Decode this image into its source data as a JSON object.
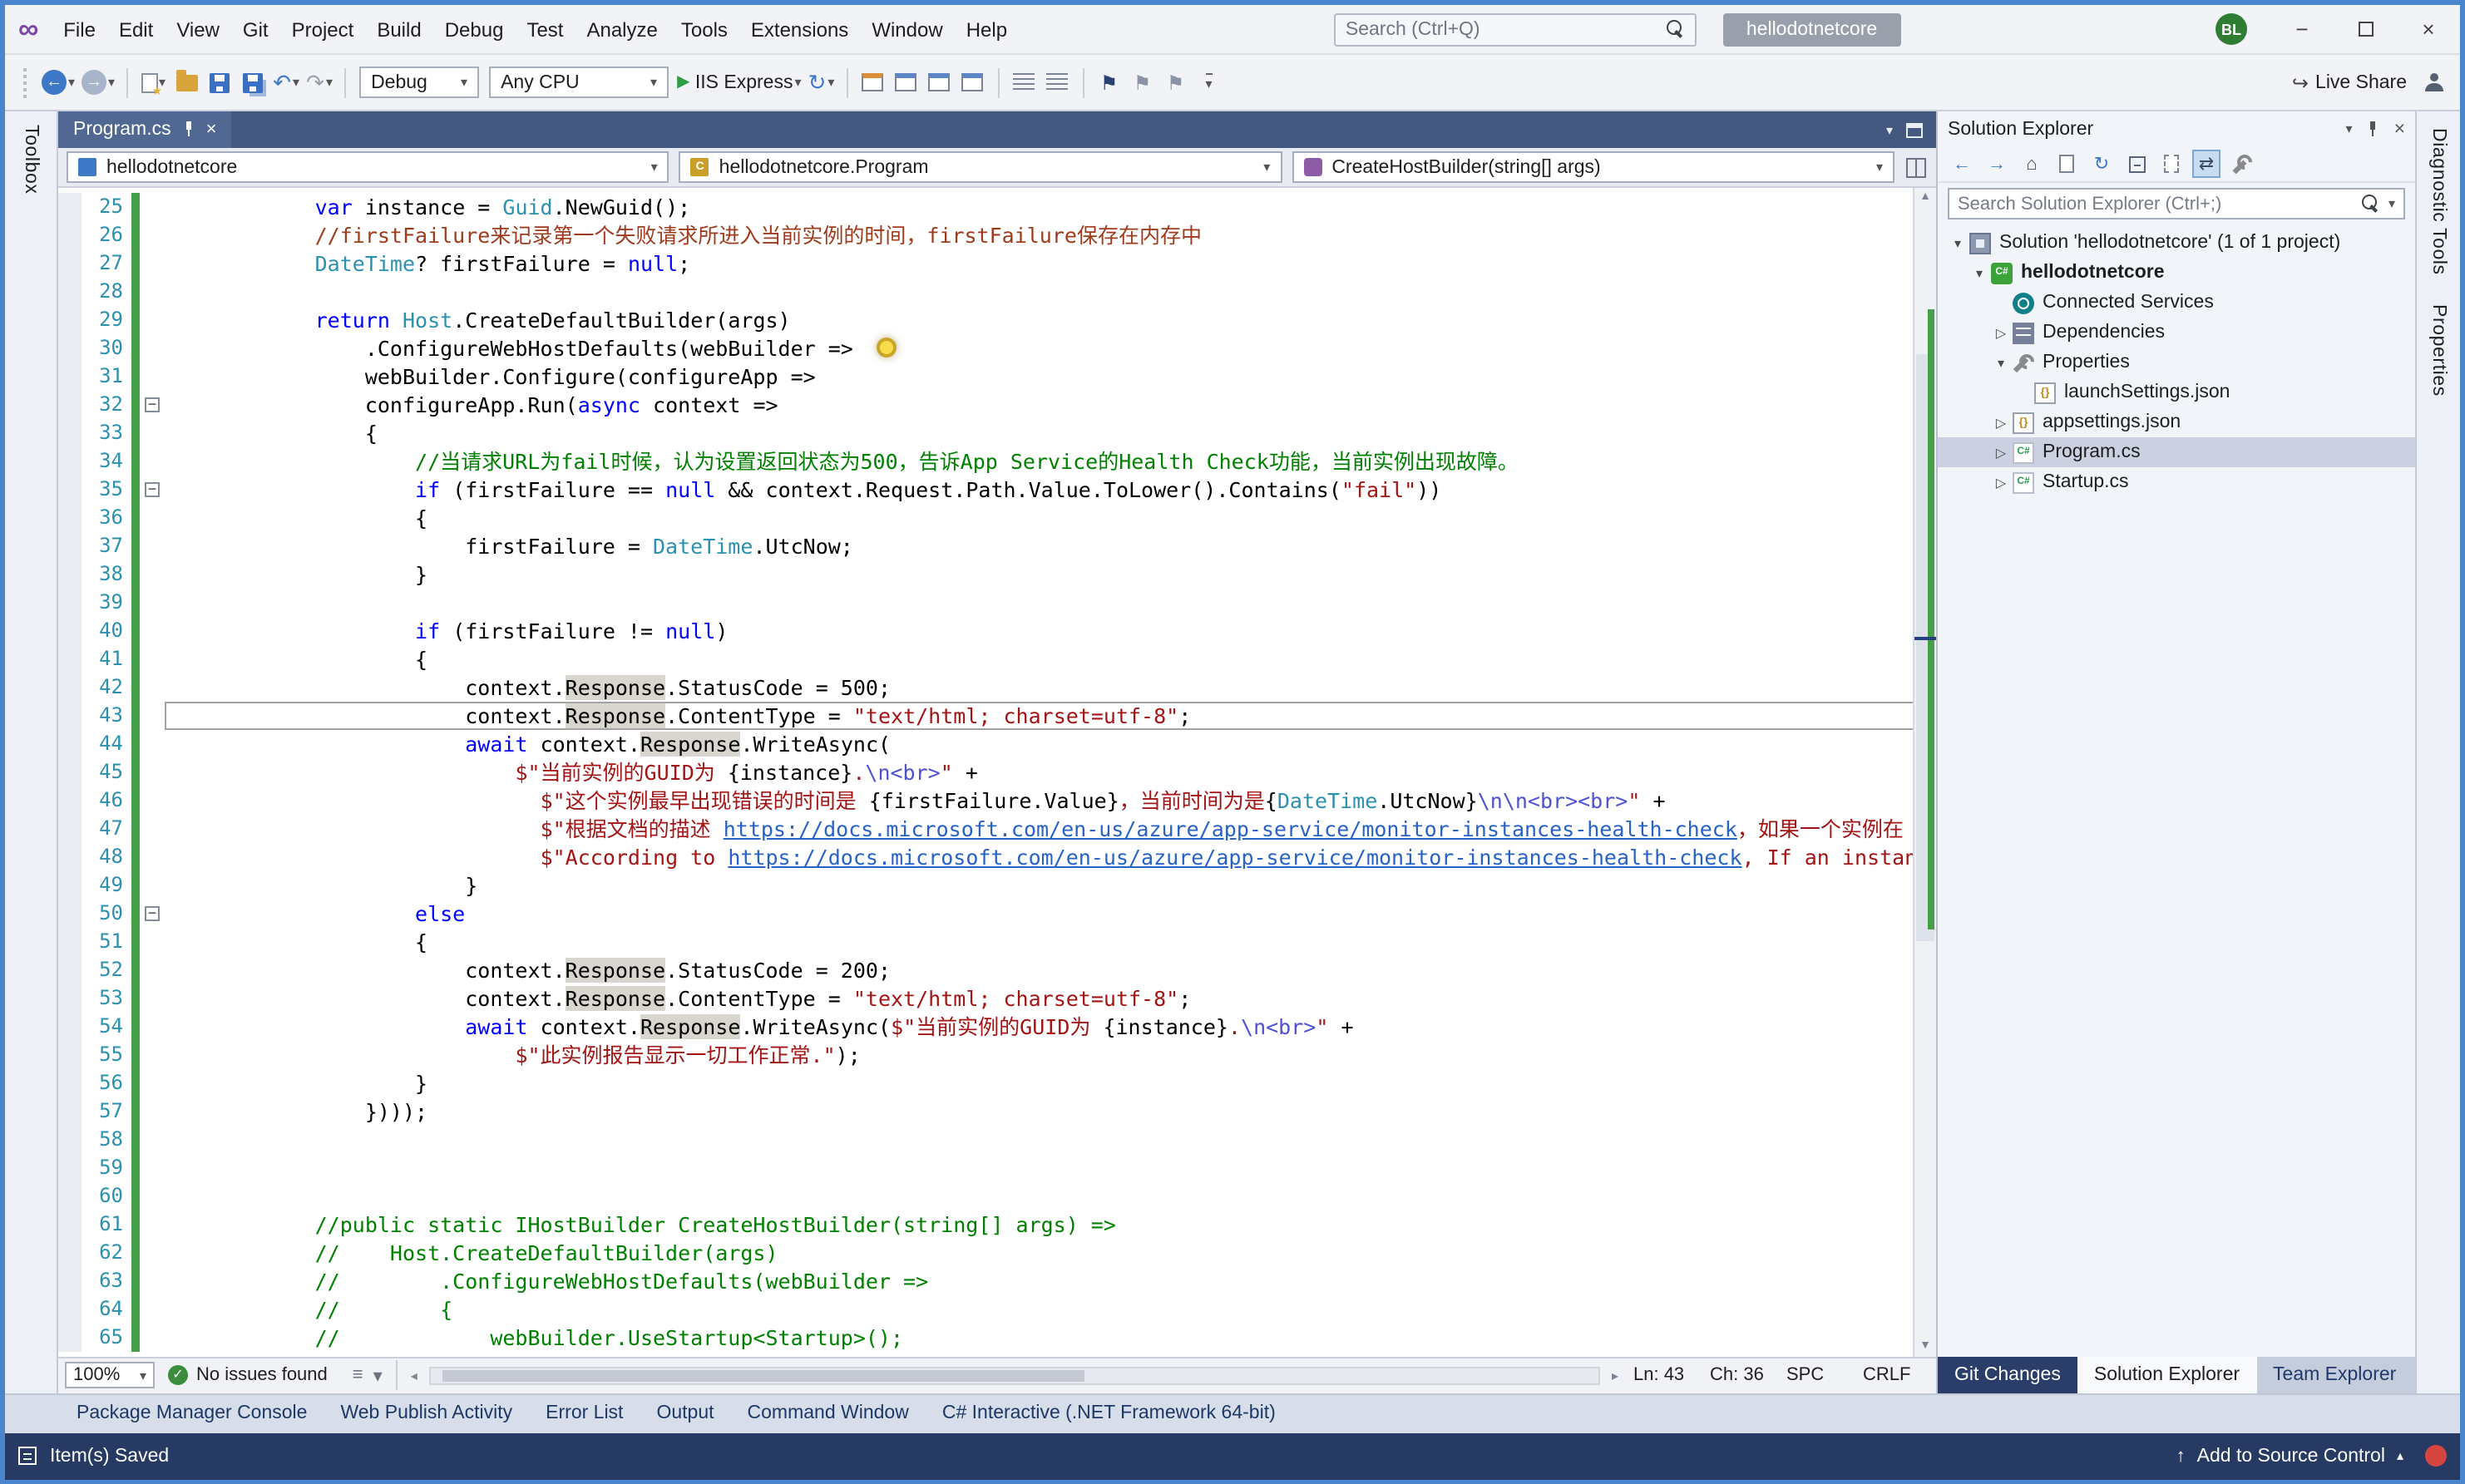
{
  "titlebar": {
    "menus": [
      "File",
      "Edit",
      "View",
      "Git",
      "Project",
      "Build",
      "Debug",
      "Test",
      "Analyze",
      "Tools",
      "Extensions",
      "Window",
      "Help"
    ],
    "search_placeholder": "Search (Ctrl+Q)",
    "solution_pill": "hellodotnetcore",
    "avatar": "BL"
  },
  "toolbar": {
    "config": "Debug",
    "platform": "Any CPU",
    "run": "IIS Express",
    "live_share": "Live Share"
  },
  "left_rail": {
    "toolbox_label": "Toolbox"
  },
  "right_rail": {
    "labels": [
      "Diagnostic Tools",
      "Properties"
    ]
  },
  "editor": {
    "tab": {
      "title": "Program.cs"
    },
    "navbar": {
      "project": "hellodotnetcore",
      "type": "hellodotnetcore.Program",
      "member": "CreateHostBuilder(string[] args)"
    },
    "statusbar": {
      "zoom": "100%",
      "issues": "No issues found",
      "ln": "Ln: 43",
      "ch": "Ch: 36",
      "ins": "SPC",
      "eol": "CRLF"
    },
    "code": {
      "lines": [
        {
          "n": 25,
          "segs": [
            [
              "p",
              "            "
            ],
            [
              "k",
              "var"
            ],
            [
              "p",
              " instance = "
            ],
            [
              "t",
              "Guid"
            ],
            [
              "p",
              ".NewGuid();"
            ]
          ]
        },
        {
          "n": 26,
          "segs": [
            [
              "cr",
              "            //firstFailure来记录第一个失败请求所进入当前实例的时间，firstFailure保存在内存中"
            ]
          ]
        },
        {
          "n": 27,
          "segs": [
            [
              "p",
              "            "
            ],
            [
              "t",
              "DateTime"
            ],
            [
              "p",
              "? firstFailure = "
            ],
            [
              "k",
              "null"
            ],
            [
              "p",
              ";"
            ]
          ]
        },
        {
          "n": 28,
          "segs": []
        },
        {
          "n": 29,
          "segs": [
            [
              "p",
              "            "
            ],
            [
              "k",
              "return"
            ],
            [
              "p",
              " "
            ],
            [
              "t",
              "Host"
            ],
            [
              "p",
              ".CreateDefaultBuilder(args)"
            ]
          ]
        },
        {
          "n": 30,
          "segs": [
            [
              "p",
              "                .ConfigureWebHostDefaults(webBuilder =>"
            ]
          ]
        },
        {
          "n": 31,
          "segs": [
            [
              "p",
              "                webBuilder.Configure(configureApp =>"
            ]
          ]
        },
        {
          "n": 32,
          "fold": true,
          "segs": [
            [
              "p",
              "                configureApp.Run("
            ],
            [
              "k",
              "async"
            ],
            [
              "p",
              " context =>"
            ]
          ]
        },
        {
          "n": 33,
          "segs": [
            [
              "p",
              "                {"
            ]
          ]
        },
        {
          "n": 34,
          "segs": [
            [
              "c",
              "                    //当请求URL为fail时候，认为设置返回状态为500，告诉App Service的Health Check功能，当前实例出现故障。"
            ]
          ]
        },
        {
          "n": 35,
          "fold": true,
          "segs": [
            [
              "p",
              "                    "
            ],
            [
              "k",
              "if"
            ],
            [
              "p",
              " (firstFailure == "
            ],
            [
              "k",
              "null"
            ],
            [
              "p",
              " && context.Request.Path.Value.ToLower().Contains("
            ],
            [
              "s",
              "\"fail\""
            ],
            [
              "p",
              "))"
            ]
          ]
        },
        {
          "n": 36,
          "segs": [
            [
              "p",
              "                    {"
            ]
          ]
        },
        {
          "n": 37,
          "segs": [
            [
              "p",
              "                        firstFailure = "
            ],
            [
              "t",
              "DateTime"
            ],
            [
              "p",
              ".UtcNow;"
            ]
          ]
        },
        {
          "n": 38,
          "segs": [
            [
              "p",
              "                    }"
            ]
          ]
        },
        {
          "n": 39,
          "segs": []
        },
        {
          "n": 40,
          "segs": [
            [
              "p",
              "                    "
            ],
            [
              "k",
              "if"
            ],
            [
              "p",
              " (firstFailure != "
            ],
            [
              "k",
              "null"
            ],
            [
              "p",
              ")"
            ]
          ]
        },
        {
          "n": 41,
          "segs": [
            [
              "p",
              "                    {"
            ]
          ]
        },
        {
          "n": 42,
          "segs": [
            [
              "p",
              "                        context."
            ],
            [
              "hl",
              "Response"
            ],
            [
              "p",
              ".StatusCode = 500;"
            ]
          ]
        },
        {
          "n": 43,
          "current": true,
          "segs": [
            [
              "p",
              "                        context."
            ],
            [
              "hl",
              "Response"
            ],
            [
              "p",
              ".ContentType = "
            ],
            [
              "s",
              "\"text/html; charset=utf-8\""
            ],
            [
              "p",
              ";"
            ]
          ]
        },
        {
          "n": 44,
          "segs": [
            [
              "p",
              "                        "
            ],
            [
              "k",
              "await"
            ],
            [
              "p",
              " context."
            ],
            [
              "hl",
              "Response"
            ],
            [
              "p",
              ".WriteAsync("
            ]
          ]
        },
        {
          "n": 45,
          "segs": [
            [
              "p",
              "                            "
            ],
            [
              "s",
              "$\"当前实例的GUID为 "
            ],
            [
              "p",
              "{instance}"
            ],
            [
              "s",
              "."
            ],
            [
              "e",
              "\\n<br>"
            ],
            [
              "s",
              "\""
            ],
            [
              "p",
              " +"
            ]
          ]
        },
        {
          "n": 46,
          "segs": [
            [
              "p",
              "                              "
            ],
            [
              "s",
              "$\"这个实例最早出现错误的时间是 "
            ],
            [
              "p",
              "{firstFailure.Value}"
            ],
            [
              "s",
              "，当前时间为是"
            ],
            [
              "p",
              "{"
            ],
            [
              "t",
              "DateTime"
            ],
            [
              "p",
              ".UtcNow}"
            ],
            [
              "e",
              "\\n\\n<br><br>"
            ],
            [
              "s",
              "\""
            ],
            [
              "p",
              " +"
            ]
          ]
        },
        {
          "n": 47,
          "segs": [
            [
              "p",
              "                              "
            ],
            [
              "s",
              "$\"根据文档的描述 "
            ],
            [
              "u",
              "https://docs.microsoft.com/en-us/azure/app-service/monitor-instances-health-check"
            ],
            [
              "s",
              "，如果一个实例在"
            ]
          ]
        },
        {
          "n": 48,
          "segs": [
            [
              "p",
              "                              "
            ],
            [
              "s",
              "$\"According to "
            ],
            [
              "u",
              "https://docs.microsoft.com/en-us/azure/app-service/monitor-instances-health-check"
            ],
            [
              "s",
              ", If an instance"
            ]
          ]
        },
        {
          "n": 49,
          "segs": [
            [
              "p",
              "                        }"
            ]
          ]
        },
        {
          "n": 50,
          "fold": true,
          "segs": [
            [
              "p",
              "                    "
            ],
            [
              "k",
              "else"
            ]
          ]
        },
        {
          "n": 51,
          "segs": [
            [
              "p",
              "                    {"
            ]
          ]
        },
        {
          "n": 52,
          "segs": [
            [
              "p",
              "                        context."
            ],
            [
              "hl",
              "Response"
            ],
            [
              "p",
              ".StatusCode = 200;"
            ]
          ]
        },
        {
          "n": 53,
          "segs": [
            [
              "p",
              "                        context."
            ],
            [
              "hl",
              "Response"
            ],
            [
              "p",
              ".ContentType = "
            ],
            [
              "s",
              "\"text/html; charset=utf-8\""
            ],
            [
              "p",
              ";"
            ]
          ]
        },
        {
          "n": 54,
          "segs": [
            [
              "p",
              "                        "
            ],
            [
              "k",
              "await"
            ],
            [
              "p",
              " context."
            ],
            [
              "hl",
              "Response"
            ],
            [
              "p",
              ".WriteAsync("
            ],
            [
              "s",
              "$\"当前实例的GUID为 "
            ],
            [
              "p",
              "{instance}"
            ],
            [
              "s",
              "."
            ],
            [
              "e",
              "\\n<br>"
            ],
            [
              "s",
              "\""
            ],
            [
              "p",
              " +"
            ]
          ]
        },
        {
          "n": 55,
          "segs": [
            [
              "p",
              "                            "
            ],
            [
              "s",
              "$\"此实例报告显示一切工作正常.\""
            ],
            [
              "p",
              ");"
            ]
          ]
        },
        {
          "n": 56,
          "segs": [
            [
              "p",
              "                    }"
            ]
          ]
        },
        {
          "n": 57,
          "segs": [
            [
              "p",
              "                })));"
            ]
          ]
        },
        {
          "n": 58,
          "segs": []
        },
        {
          "n": 59,
          "segs": []
        },
        {
          "n": 60,
          "segs": []
        },
        {
          "n": 61,
          "segs": [
            [
              "c",
              "            //public static IHostBuilder CreateHostBuilder(string[] args) =>"
            ]
          ]
        },
        {
          "n": 62,
          "segs": [
            [
              "c",
              "            //    Host.CreateDefaultBuilder(args)"
            ]
          ]
        },
        {
          "n": 63,
          "segs": [
            [
              "c",
              "            //        .ConfigureWebHostDefaults(webBuilder =>"
            ]
          ]
        },
        {
          "n": 64,
          "segs": [
            [
              "c",
              "            //        {"
            ]
          ]
        },
        {
          "n": 65,
          "segs": [
            [
              "c",
              "            //            webBuilder.UseStartup<Startup>();"
            ]
          ]
        }
      ]
    }
  },
  "solution_explorer": {
    "title": "Solution Explorer",
    "search_placeholder": "Search Solution Explorer (Ctrl+;)",
    "tree": [
      {
        "label": "Solution 'hellodotnetcore' (1 of 1 project)",
        "indent": 0,
        "arrow": "exp",
        "icon": "solution"
      },
      {
        "label": "hellodotnetcore",
        "indent": 1,
        "arrow": "exp",
        "icon": "csproj",
        "bold": true
      },
      {
        "label": "Connected Services",
        "indent": 2,
        "arrow": "none",
        "icon": "connected"
      },
      {
        "label": "Dependencies",
        "indent": 2,
        "arrow": "col",
        "icon": "deps"
      },
      {
        "label": "Properties",
        "indent": 2,
        "arrow": "exp",
        "icon": "props"
      },
      {
        "label": "launchSettings.json",
        "indent": 3,
        "arrow": "none",
        "icon": "json"
      },
      {
        "label": "appsettings.json",
        "indent": 2,
        "arrow": "col",
        "icon": "json"
      },
      {
        "label": "Program.cs",
        "indent": 2,
        "arrow": "col",
        "icon": "cs",
        "selected": true
      },
      {
        "label": "Startup.cs",
        "indent": 2,
        "arrow": "col",
        "icon": "cs"
      }
    ],
    "tabs": [
      {
        "label": "Git Changes",
        "state": "dark"
      },
      {
        "label": "Solution Explorer",
        "state": "active"
      },
      {
        "label": "Team Explorer",
        "state": "plain"
      }
    ]
  },
  "bottom_tabs": [
    "Package Manager Console",
    "Web Publish Activity",
    "Error List",
    "Output",
    "Command Window",
    "C# Interactive (.NET Framework 64-bit)"
  ],
  "statusbar": {
    "message": "Item(s) Saved",
    "add_to_source_control": "Add to Source Control"
  },
  "colors": {
    "window_border": "#4A86CE",
    "statusbar_bg": "#273A64",
    "change_tracking_green": "#45A148",
    "keyword_blue": "#0000FF",
    "type_teal": "#2B91AF",
    "string_red": "#A31515",
    "comment_green": "#008000",
    "selection_bg": "#CBD1E0",
    "avatar_green": "#2E7D32"
  }
}
